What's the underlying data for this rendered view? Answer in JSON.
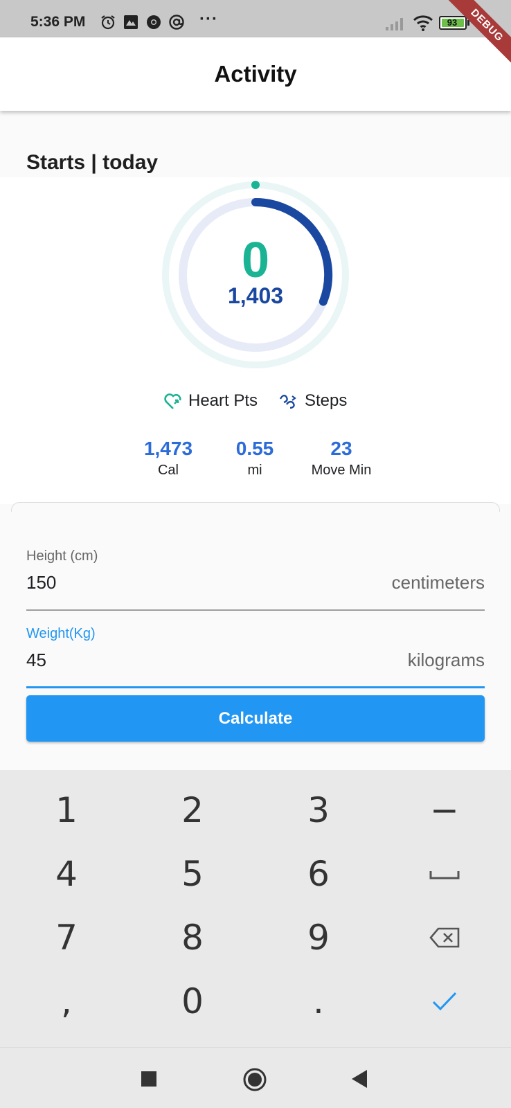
{
  "status_bar": {
    "time": "5:36 PM",
    "icons": [
      "alarm-icon",
      "app-icon",
      "chrome-icon",
      "at-icon",
      "more-icon",
      "signal-icon",
      "wifi-icon",
      "battery-icon"
    ],
    "more": "···",
    "battery": "93",
    "debug_banner": "DEBUG"
  },
  "app_bar": {
    "title": "Activity"
  },
  "section": {
    "title": "Starts | today"
  },
  "ring": {
    "heart_pts": "0",
    "steps": "1,403",
    "heart_color": "#1ab394",
    "steps_color": "#1a47a0"
  },
  "legend": {
    "heart_label": "Heart Pts",
    "steps_label": "Steps"
  },
  "stats": [
    {
      "value": "1,473",
      "label": "Cal"
    },
    {
      "value": "0.55",
      "label": "mi"
    },
    {
      "value": "23",
      "label": "Move Min"
    }
  ],
  "form": {
    "height": {
      "label": "Height (cm)",
      "value": "150",
      "suffix": "centimeters"
    },
    "weight": {
      "label": "Weight(Kg)",
      "value": "45",
      "suffix": "kilograms"
    },
    "calculate_label": "Calculate",
    "accent": "#2196f3"
  },
  "keyboard": {
    "keys": [
      "1",
      "2",
      "3",
      "−",
      "4",
      "5",
      "6",
      "␣",
      "7",
      "8",
      "9",
      "⌫",
      ",",
      "0",
      ".",
      "✓"
    ]
  },
  "nav_bar": {
    "icons": [
      "recent-apps-icon",
      "home-icon",
      "back-icon"
    ]
  }
}
